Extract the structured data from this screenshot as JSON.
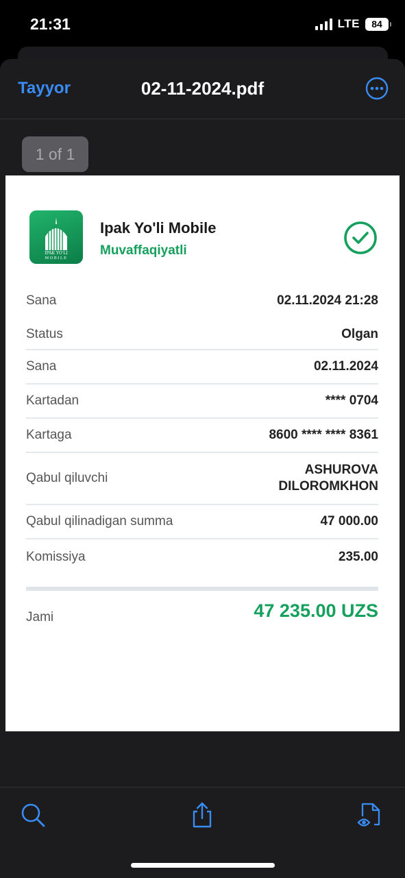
{
  "status_bar": {
    "time": "21:31",
    "network": "LTE",
    "battery": "84"
  },
  "nav": {
    "done_label": "Tayyor",
    "title": "02-11-2024.pdf",
    "more_icon": "ellipsis-circle-icon"
  },
  "page_indicator": "1 of 1",
  "receipt": {
    "bank_name": "Ipak Yo'li Mobile",
    "status_text": "Muvaffaqiyatli",
    "logo_text": [
      "IPAK YO'LI",
      "MOBILE"
    ],
    "rows": [
      {
        "label": "Sana",
        "value": "02.11.2024 21:28"
      },
      {
        "label": "Status",
        "value": "Olgan"
      },
      {
        "label": "Sana",
        "value": "02.11.2024"
      },
      {
        "label": "Kartadan",
        "value": "**** 0704"
      },
      {
        "label": "Kartaga",
        "value": "8600 **** **** 8361"
      },
      {
        "label": "Qabul qiluvchi",
        "value": "ASHUROVA\nDILOROMKHON"
      },
      {
        "label": "Qabul qilinadigan summa",
        "value": "47 000.00"
      },
      {
        "label": "Komissiya",
        "value": "235.00"
      }
    ],
    "total_label": "Jami",
    "total_value": "47 235.00 UZS"
  },
  "toolbar": {
    "search_icon": "search-icon",
    "share_icon": "share-icon",
    "markup_icon": "document-view-icon"
  },
  "colors": {
    "accent": "#3a8cf5",
    "success": "#16a05e",
    "background": "#1c1c1e"
  }
}
